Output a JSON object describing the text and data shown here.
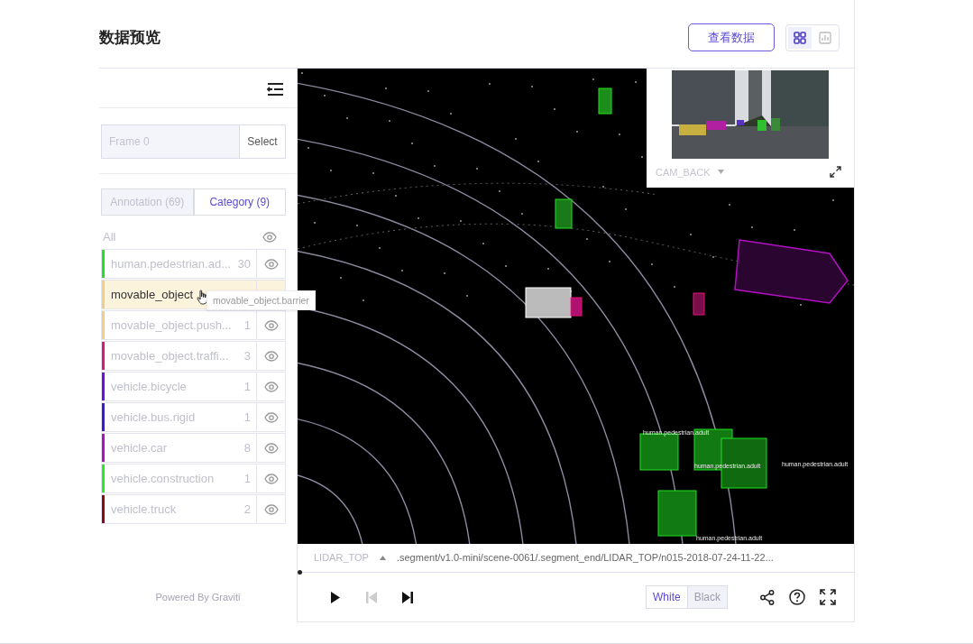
{
  "title": "数据预览",
  "view_data_button": "查看数据",
  "view_modes": [
    {
      "kind": "grid",
      "selected": true
    },
    {
      "kind": "chart",
      "selected": false
    }
  ],
  "frame": {
    "placeholder": "Frame 0",
    "button": "Select"
  },
  "tabs": [
    {
      "label": "Annotation (69)",
      "selected": false
    },
    {
      "label": "Category (9)",
      "selected": true
    }
  ],
  "all_label": "All",
  "categories": [
    {
      "name": "human.pedestrian.ad...",
      "count": "30",
      "color": "#22e022",
      "hovered": false
    },
    {
      "name": "movable_object",
      "color": "#f2cf80",
      "hovered": true
    },
    {
      "name": "movable_object.push...",
      "count": "1",
      "color": "#f2cf80",
      "hovered": false
    },
    {
      "name": "movable_object.traffi...",
      "count": "3",
      "color": "#e0157a",
      "hovered": false
    },
    {
      "name": "vehicle.bicycle",
      "count": "1",
      "color": "#6a10e0",
      "hovered": false
    },
    {
      "name": "vehicle.bus.rigid",
      "count": "1",
      "color": "#3a18d8",
      "hovered": false
    },
    {
      "name": "vehicle.car",
      "count": "8",
      "color": "#b010c0",
      "hovered": false
    },
    {
      "name": "vehicle.construction",
      "count": "1",
      "color": "#22ee22",
      "hovered": false
    },
    {
      "name": "vehicle.truck",
      "count": "2",
      "color": "#8b0a14",
      "hovered": false
    }
  ],
  "tooltip": "movable_object.barrier",
  "footer": "Powered By Graviti",
  "camera": {
    "name": "CAM_BACK"
  },
  "lidar": {
    "name": "LIDAR_TOP",
    "path": ".segment/v1.0-mini/scene-0061/.segment_end/LIDAR_TOP/n015-2018-07-24-11-22...",
    "level": 0,
    "annotations": [
      {
        "label": "human.pedestrian.adult"
      },
      {
        "label": "human.pedestrian.adult"
      },
      {
        "label": "human.pedestrian.adult"
      },
      {
        "label": "human.pedestrian.adult"
      }
    ]
  },
  "playback": [
    {
      "kind": "play",
      "disabled": false
    },
    {
      "kind": "prev",
      "disabled": true
    },
    {
      "kind": "next",
      "disabled": false
    }
  ],
  "background_modes": [
    {
      "label": "White",
      "selected": true
    },
    {
      "label": "Black",
      "selected": false
    }
  ]
}
